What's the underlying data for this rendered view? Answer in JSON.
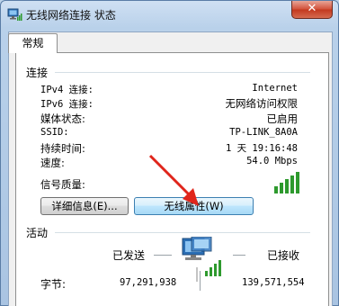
{
  "window": {
    "title": "无线网络连接 状态",
    "close_glyph": "✕"
  },
  "tabs": [
    {
      "label": "常规"
    }
  ],
  "connection": {
    "heading": "连接",
    "rows": [
      {
        "label": "IPv4 连接:",
        "value": "Internet"
      },
      {
        "label": "IPv6 连接:",
        "value": "无网络访问权限"
      },
      {
        "label": "媒体状态:",
        "value": "已启用"
      },
      {
        "label": "SSID:",
        "value": "TP-LINK_8A0A"
      },
      {
        "label": "持续时间:",
        "value": "1 天 19:16:48"
      },
      {
        "label": "速度:",
        "value": "54.0 Mbps"
      }
    ],
    "signal_label": "信号质量:",
    "signal_bars": 5,
    "signal_bars_filled": 5
  },
  "buttons": {
    "details": "详细信息(E)...",
    "wireless_props": "无线属性(W)"
  },
  "activity": {
    "heading": "活动",
    "sent_label": "已发送",
    "received_label": "已接收",
    "bytes_label": "字节:",
    "bytes_sent": "97,291,938",
    "bytes_received": "139,571,554"
  },
  "colors": {
    "accent_arrow": "#e0251b",
    "signal_green": "#2e9a2e",
    "title_close": "#c2391f"
  }
}
